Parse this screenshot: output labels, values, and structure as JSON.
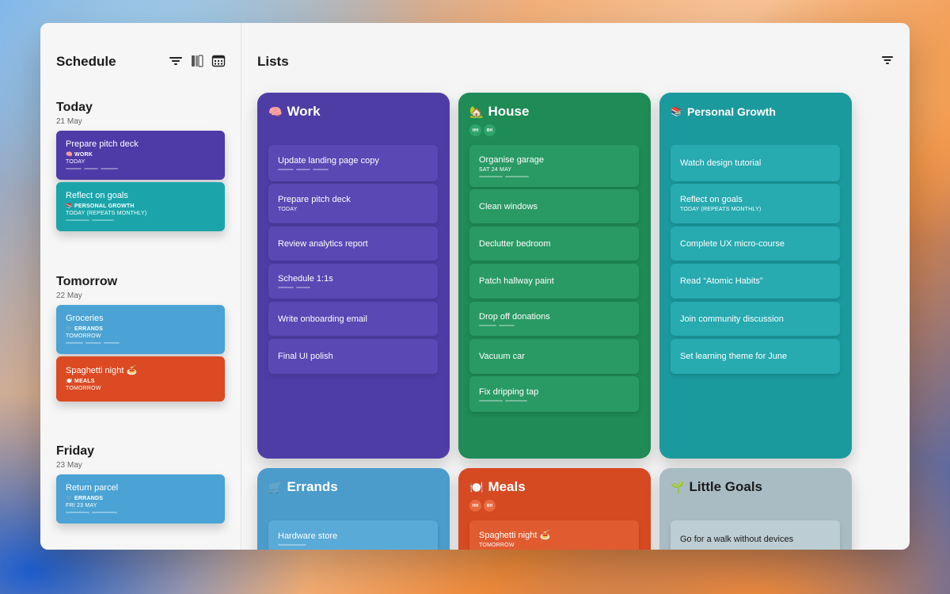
{
  "sidebar": {
    "title": "Schedule",
    "days": [
      {
        "name": "Today",
        "date": "21 May",
        "items": [
          {
            "title": "Prepare pitch deck",
            "list": "🧠 WORK",
            "date": "TODAY",
            "color": "#4e3ba8"
          },
          {
            "title": "Reflect on goals",
            "list": "📚 PERSONAL GROWTH",
            "date": "TODAY (REPEATS MONTHLY)",
            "color": "#1ba5ab"
          }
        ]
      },
      {
        "name": "Tomorrow",
        "date": "22 May",
        "items": [
          {
            "title": "Groceries",
            "list": "🛒 ERRANDS",
            "date": "TOMORROW",
            "color": "#4aa3d4"
          },
          {
            "title": "Spaghetti night 🍝",
            "list": "🍽️ MEALS",
            "date": "TOMORROW",
            "color": "#dc4a23"
          }
        ]
      },
      {
        "name": "Friday",
        "date": "23 May",
        "items": [
          {
            "title": "Return parcel",
            "list": "🛒 ERRANDS",
            "date": "FRI 23 MAY",
            "color": "#4aa3d4"
          }
        ]
      }
    ],
    "icons": [
      "filter-icon",
      "book-icon",
      "calendar-icon"
    ]
  },
  "main": {
    "title": "Lists",
    "lists": [
      {
        "name": "Work",
        "emoji": "🧠",
        "color": "#4f3da6",
        "task_color": "#5a48b4",
        "tasks": [
          {
            "title": "Update landing page copy",
            "sub": ""
          },
          {
            "title": "Prepare pitch deck",
            "sub": "TODAY"
          },
          {
            "title": "Review analytics report",
            "sub": ""
          },
          {
            "title": "Schedule 1:1s",
            "sub": ""
          },
          {
            "title": "Write onboarding email",
            "sub": ""
          },
          {
            "title": "Final UI polish",
            "sub": ""
          }
        ]
      },
      {
        "name": "House",
        "emoji": "🏡",
        "color": "#1f8b57",
        "task_color": "#2a9a64",
        "avatars": [
          "HH",
          "BH"
        ],
        "tasks": [
          {
            "title": "Organise garage",
            "sub": "SAT 24 MAY"
          },
          {
            "title": "Clean windows",
            "sub": ""
          },
          {
            "title": "Declutter bedroom",
            "sub": ""
          },
          {
            "title": "Patch hallway paint",
            "sub": ""
          },
          {
            "title": "Drop off donations",
            "sub": ""
          },
          {
            "title": "Vacuum car",
            "sub": ""
          },
          {
            "title": "Fix dripping tap",
            "sub": ""
          }
        ]
      },
      {
        "name": "Personal Growth",
        "emoji": "📚",
        "color": "#1b9a9e",
        "task_color": "#27aab0",
        "tasks": [
          {
            "title": "Watch design tutorial",
            "sub": ""
          },
          {
            "title": "Reflect on goals",
            "sub": "TODAY (REPEATS MONTHLY)"
          },
          {
            "title": "Complete UX micro-course",
            "sub": ""
          },
          {
            "title": "Read “Atomic Habits”",
            "sub": ""
          },
          {
            "title": "Join community discussion",
            "sub": ""
          },
          {
            "title": "Set learning theme for June",
            "sub": ""
          }
        ]
      },
      {
        "name": "Errands",
        "emoji": "🛒",
        "color": "#4b9ccb",
        "task_color": "#5aaad8",
        "tasks": [
          {
            "title": "Hardware store",
            "sub": ""
          }
        ]
      },
      {
        "name": "Meals",
        "emoji": "🍽️",
        "color": "#d64a22",
        "task_color": "#e05b30",
        "avatars": [
          "HH",
          "BH"
        ],
        "tasks": [
          {
            "title": "Spaghetti night 🍝",
            "sub": "TOMORROW"
          }
        ]
      },
      {
        "name": "Little Goals",
        "emoji": "🌱",
        "color": "#a9bcc4",
        "task_color": "#bccdd3",
        "dark_text": true,
        "tasks": [
          {
            "title": "Go for a walk without devices",
            "sub": ""
          }
        ]
      }
    ]
  }
}
